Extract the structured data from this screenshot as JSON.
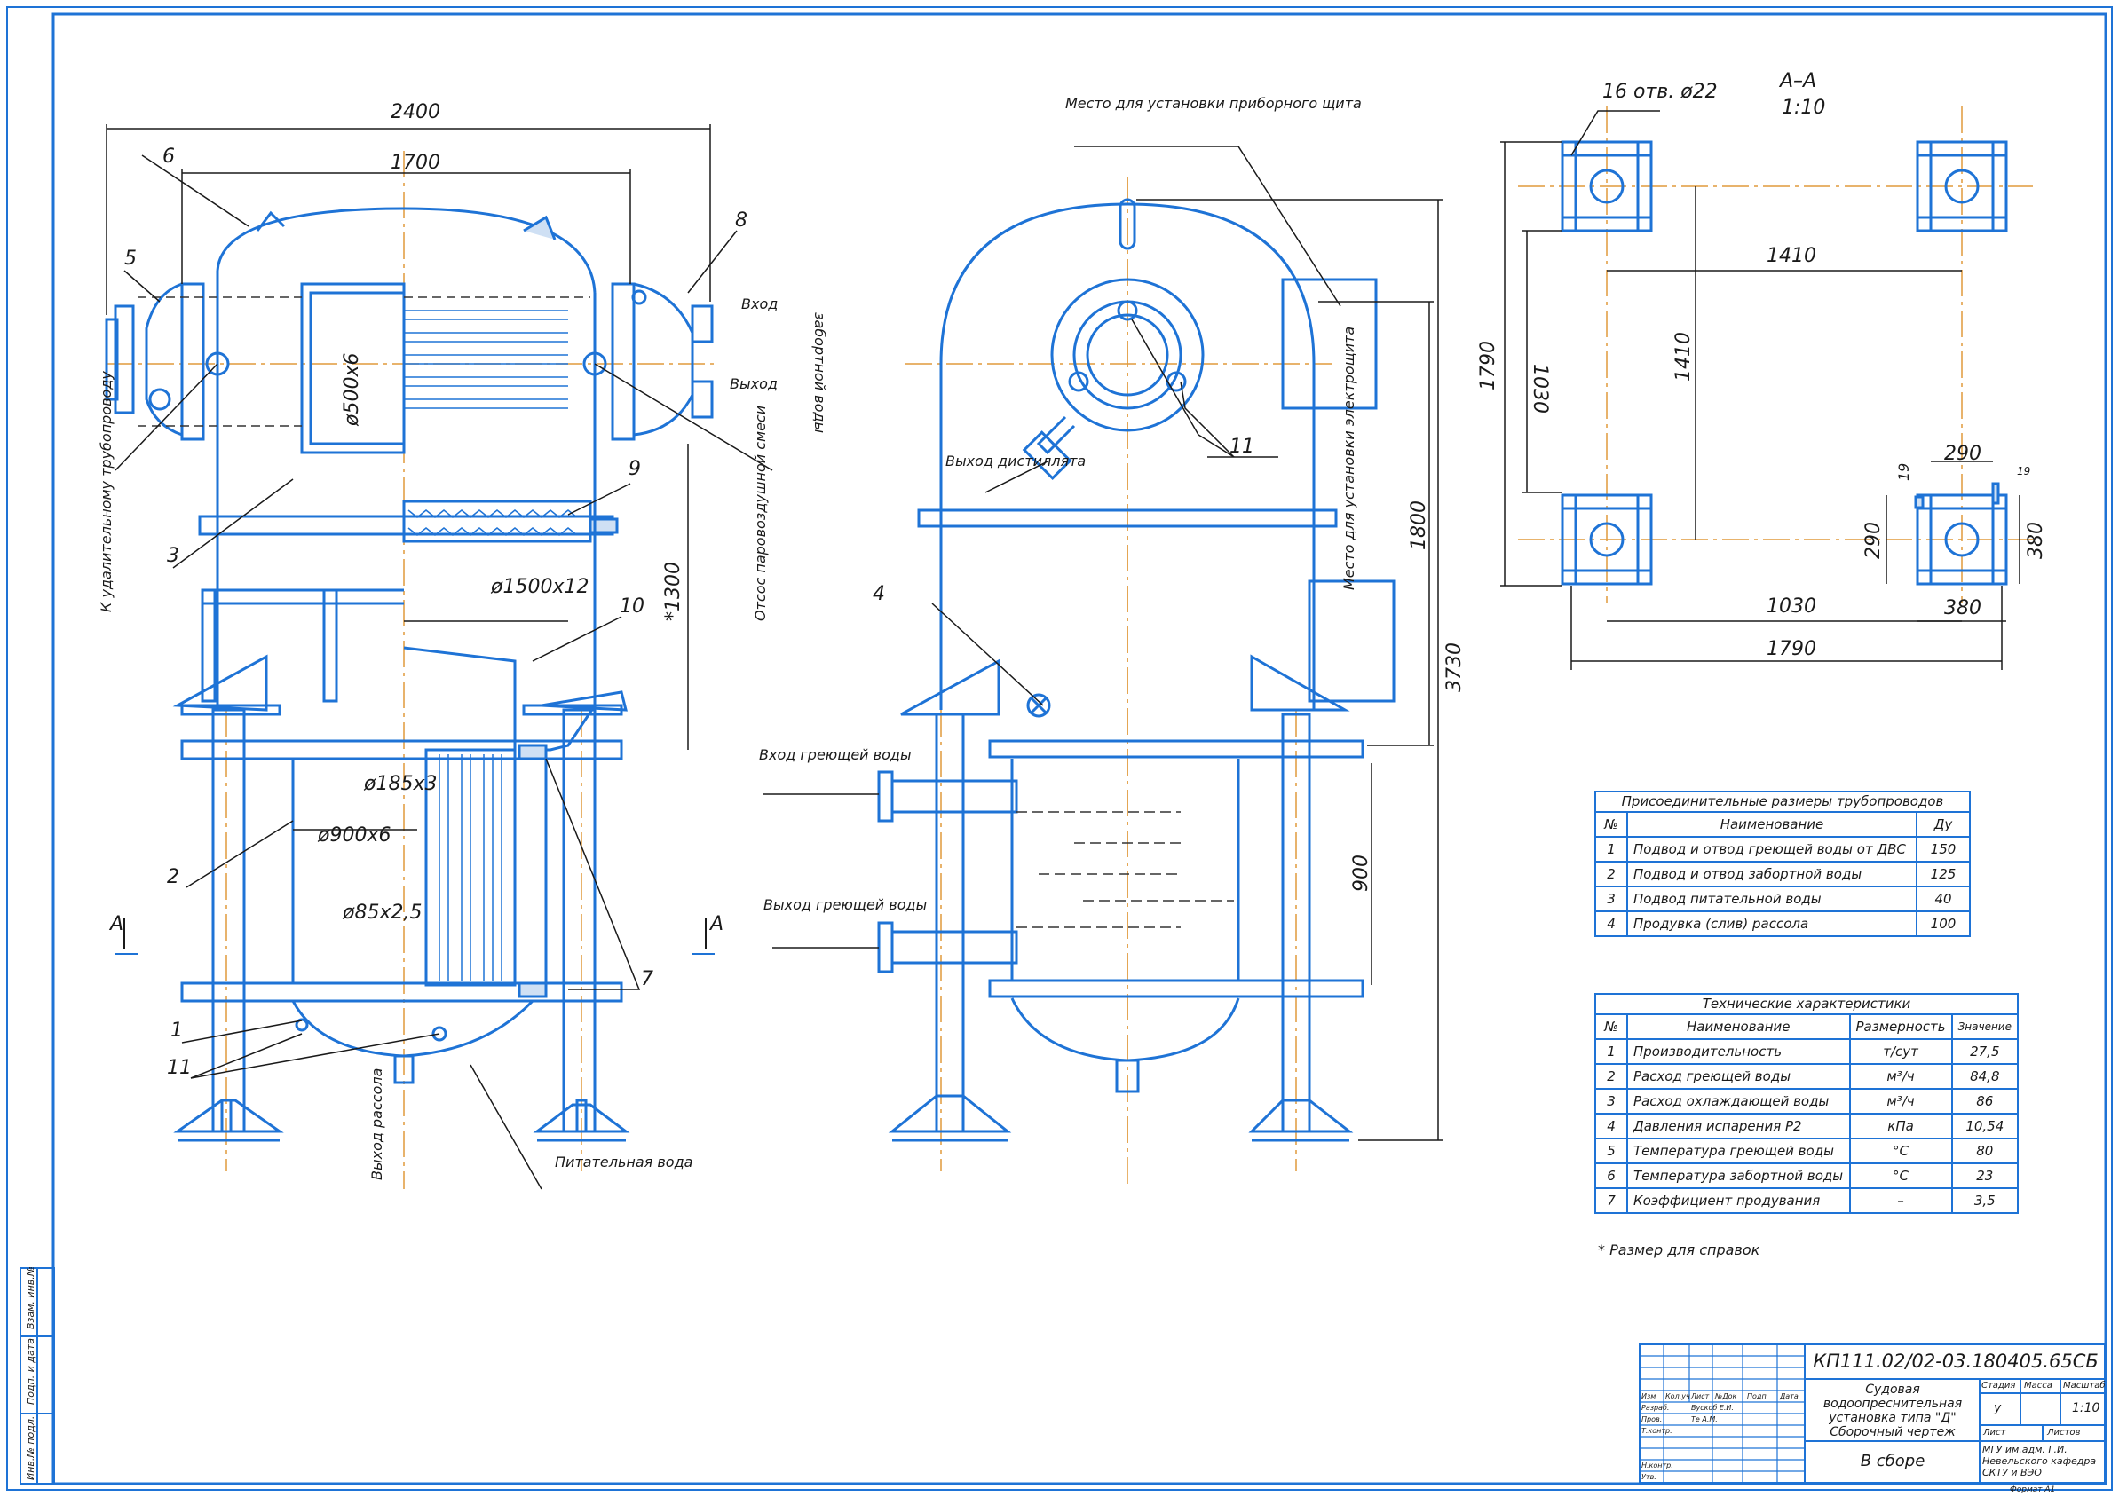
{
  "dims": {
    "d2400": "2400",
    "d1700": "1700",
    "d500x6": "ø500х6",
    "d1500x12": "ø1500х12",
    "d1300": "*1300",
    "d185x3": "ø185х3",
    "d900x6": "ø900х6",
    "d85x25": "ø85х2,5",
    "d1790a": "1790",
    "d3730": "3730",
    "d1800": "1800",
    "d900": "900",
    "holes": "16 отв. ø22",
    "sectionAA": "А–А",
    "scale": "1:10",
    "d1410a": "1410",
    "d1030a": "1030",
    "d1410b": "1410",
    "d1030b": "1030",
    "d1790b": "1790",
    "d380a": "380",
    "d380b": "380",
    "d290a": "290",
    "d290b": "290",
    "d19a": "19",
    "d19b": "19"
  },
  "callouts": {
    "n1": "1",
    "n2": "2",
    "n3": "3",
    "n4": "4",
    "n5": "5",
    "n6": "6",
    "n7": "7",
    "n8": "8",
    "n9": "9",
    "n10": "10",
    "n11a": "11",
    "n11b": "11",
    "arrowA1": "А",
    "arrowA2": "А"
  },
  "notes": {
    "inlet": "Вход",
    "outlet": "Выход",
    "seawater": "забортной воды",
    "toEjector": "К удалительному трубопроводу",
    "suction": "Отсос паровоздушной смеси",
    "brineOut": "Выход рассола",
    "feedWater": "Питательная вода",
    "panelPlace": "Место для установки приборного щита",
    "distOut": "Выход дистиллята",
    "elPanelPlace": "Место для установки электрощита",
    "heatIn": "Вход греющей воды",
    "heatOut": "Выход греющей воды",
    "refNote": "* Размер для справок"
  },
  "conn_table": {
    "title": "Присоединительные размеры трубопроводов",
    "headers": [
      "№",
      "Наименование",
      "Ду"
    ],
    "rows": [
      [
        "1",
        "Подвод и отвод греющей воды от ДВС",
        "150"
      ],
      [
        "2",
        "Подвод и отвод забортной воды",
        "125"
      ],
      [
        "3",
        "Подвод питательной воды",
        "40"
      ],
      [
        "4",
        "Продувка (слив) рассола",
        "100"
      ]
    ]
  },
  "tech_table": {
    "title": "Технические характеристики",
    "headers": [
      "№",
      "Наименование",
      "Размерность",
      "Значение"
    ],
    "rows": [
      [
        "1",
        "Производительность",
        "т/сут",
        "27,5"
      ],
      [
        "2",
        "Расход греющей воды",
        "м³/ч",
        "84,8"
      ],
      [
        "3",
        "Расход охлаждающей воды",
        "м³/ч",
        "86"
      ],
      [
        "4",
        "Давления испарения Р2",
        "кПа",
        "10,54"
      ],
      [
        "5",
        "Температура греющей воды",
        "°С",
        "80"
      ],
      [
        "6",
        "Температура забортной воды",
        "°С",
        "23"
      ],
      [
        "7",
        "Коэффициент продувания",
        "–",
        "3,5"
      ]
    ]
  },
  "stamp": {
    "code": "КП111.02/02-03.180405.65СБ",
    "title": "Судовая водоопреснительная установка типа \"Д\" Сборочный чертеж",
    "subtitle": "В сборе",
    "stage": "Стадия",
    "mass": "Масса",
    "scaleLbl": "Масштаб",
    "stageVal": "у",
    "scaleVal": "1:10",
    "sheet": "Лист",
    "sheets": "Листов",
    "org": "МГУ им.адм. Г.И. Невельского кафедра СКТУ и ВЭО",
    "format": "Формат А1",
    "cols": [
      "Изм",
      "Кол.уч",
      "Лист",
      "№Док",
      "Подп",
      "Дата"
    ],
    "rows": [
      "Разраб.",
      "Пров.",
      "Т.контр.",
      "",
      "Н.контр.",
      "Утв."
    ],
    "names": [
      "Вускоб Е.И.",
      "Те А.М."
    ],
    "side": [
      "Взам. инв.№",
      "Подп. и дата",
      "Инв.№ подл."
    ]
  },
  "colors": {
    "line": "#1e73d6",
    "axis": "#e09a3c",
    "text": "#1a1a1a"
  }
}
